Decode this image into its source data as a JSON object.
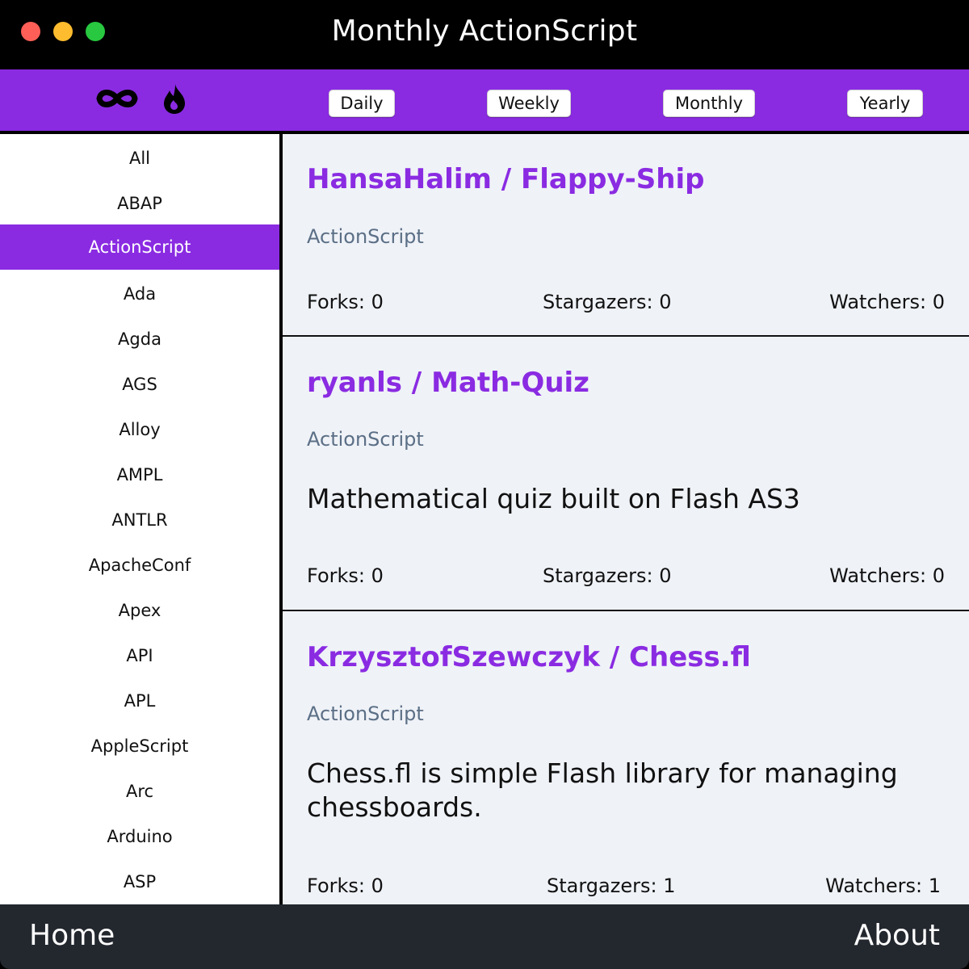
{
  "window": {
    "title": "Monthly ActionScript"
  },
  "toolbar": {
    "icons": [
      "infinity-icon",
      "flame-icon"
    ],
    "periods": [
      "Daily",
      "Weekly",
      "Monthly",
      "Yearly"
    ]
  },
  "sidebar": {
    "selected": "ActionScript",
    "items": [
      "All",
      "ABAP",
      "ActionScript",
      "Ada",
      "Agda",
      "AGS",
      "Alloy",
      "AMPL",
      "ANTLR",
      "ApacheConf",
      "Apex",
      "API",
      "APL",
      "AppleScript",
      "Arc",
      "Arduino",
      "ASP"
    ]
  },
  "repos": [
    {
      "title": "HansaHalim / Flappy-Ship",
      "language": "ActionScript",
      "description": "",
      "forks": "Forks: 0",
      "stargazers": "Stargazers: 0",
      "watchers": "Watchers: 0"
    },
    {
      "title": "ryanls / Math-Quiz",
      "language": "ActionScript",
      "description": "Mathematical quiz built on Flash AS3",
      "forks": "Forks: 0",
      "stargazers": "Stargazers: 0",
      "watchers": "Watchers: 0"
    },
    {
      "title": "KrzysztofSzewczyk / Chess.fl",
      "language": "ActionScript",
      "description": "Chess.fl is simple Flash library for managing chessboards.",
      "forks": "Forks: 0",
      "stargazers": "Stargazers: 1",
      "watchers": "Watchers: 1"
    }
  ],
  "footer": {
    "home": "Home",
    "about": "About"
  },
  "colors": {
    "accent": "#8a2be2",
    "footer": "#23272e",
    "content_bg": "#eff2f7",
    "language": "#5b6f86"
  }
}
